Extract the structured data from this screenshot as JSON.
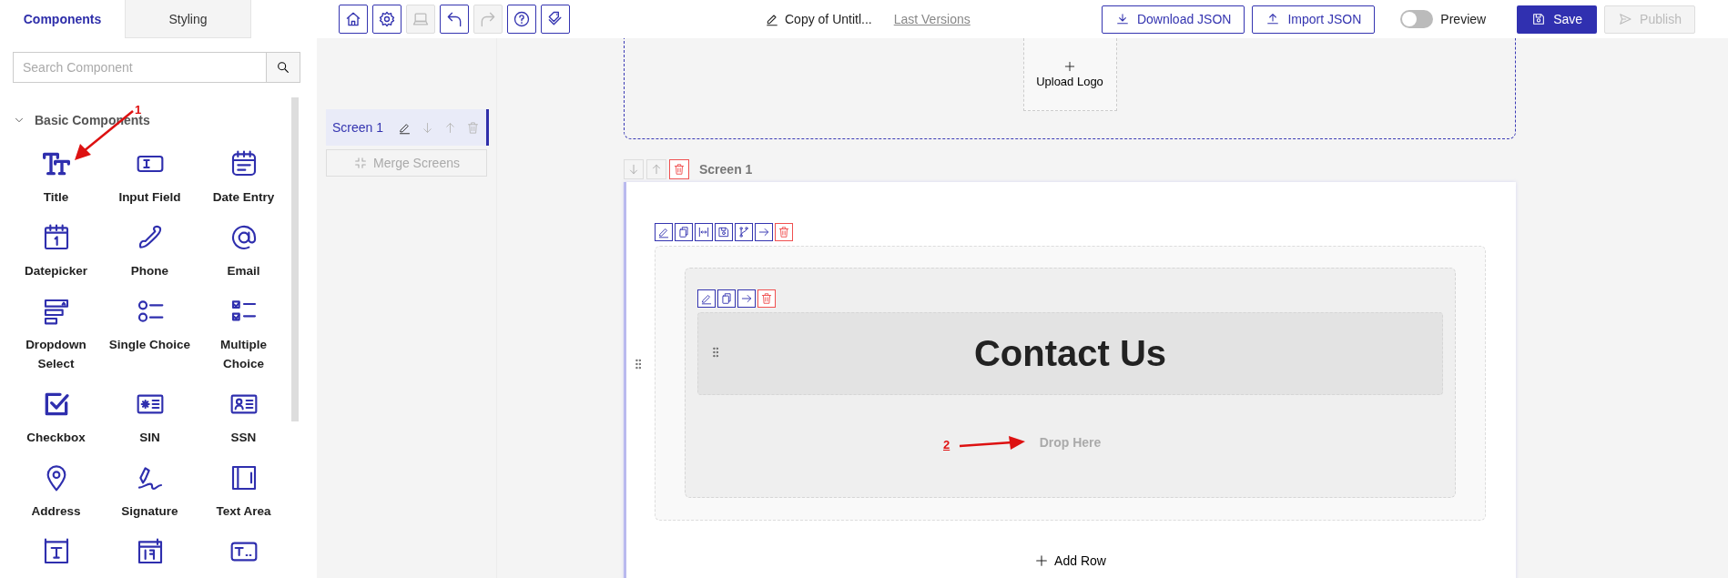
{
  "sidebar": {
    "tabs": [
      {
        "label": "Components",
        "selected": true
      },
      {
        "label": "Styling",
        "selected": false
      }
    ],
    "search": {
      "placeholder": "Search Component"
    },
    "section": {
      "title": "Basic Components",
      "expanded": true
    },
    "components": [
      {
        "kind": "title",
        "label": "Title"
      },
      {
        "kind": "input",
        "label": "Input Field"
      },
      {
        "kind": "dateentry",
        "label": "Date Entry"
      },
      {
        "kind": "datepicker",
        "label": "Datepicker"
      },
      {
        "kind": "phone",
        "label": "Phone"
      },
      {
        "kind": "email",
        "label": "Email"
      },
      {
        "kind": "dropdown",
        "label": "Dropdown Select"
      },
      {
        "kind": "single",
        "label": "Single Choice"
      },
      {
        "kind": "multiple",
        "label": "Multiple Choice"
      },
      {
        "kind": "checkbox",
        "label": "Checkbox"
      },
      {
        "kind": "sin",
        "label": "SIN"
      },
      {
        "kind": "ssn",
        "label": "SSN"
      },
      {
        "kind": "address",
        "label": "Address"
      },
      {
        "kind": "signature",
        "label": "Signature"
      },
      {
        "kind": "textarea",
        "label": "Text Area"
      },
      {
        "kind": "framed"
      },
      {
        "kind": "calendar"
      },
      {
        "kind": "textbox"
      }
    ]
  },
  "toolbar": [
    {
      "kind": "home",
      "disabled": false
    },
    {
      "kind": "settings",
      "disabled": false
    },
    {
      "kind": "laptop",
      "disabled": true
    },
    {
      "kind": "undo",
      "disabled": false
    },
    {
      "kind": "redo",
      "disabled": true
    },
    {
      "kind": "help",
      "disabled": false
    },
    {
      "kind": "tags",
      "disabled": false
    }
  ],
  "document": {
    "title": "Copy of Untitl...",
    "versions_link": "Last Versions"
  },
  "actions": [
    {
      "kind": "download",
      "label": "Download JSON"
    },
    {
      "kind": "upload",
      "label": "Import JSON"
    }
  ],
  "preview": {
    "label": "Preview",
    "on": false
  },
  "save": {
    "label": "Save"
  },
  "publish": {
    "label": "Publish",
    "disabled": true
  },
  "screens_panel": {
    "screens": [
      {
        "name": "Screen 1",
        "selected": true
      }
    ],
    "merge": {
      "label": "Merge Screens",
      "disabled": true
    }
  },
  "canvas": {
    "logo": {
      "label": "Upload Logo"
    },
    "screen": {
      "name": "Screen 1"
    },
    "title": "Contact Us",
    "drop_hint": "Drop Here",
    "add_row": "Add Row"
  },
  "annotations": [
    {
      "label": "1"
    },
    {
      "label": "2"
    }
  ]
}
